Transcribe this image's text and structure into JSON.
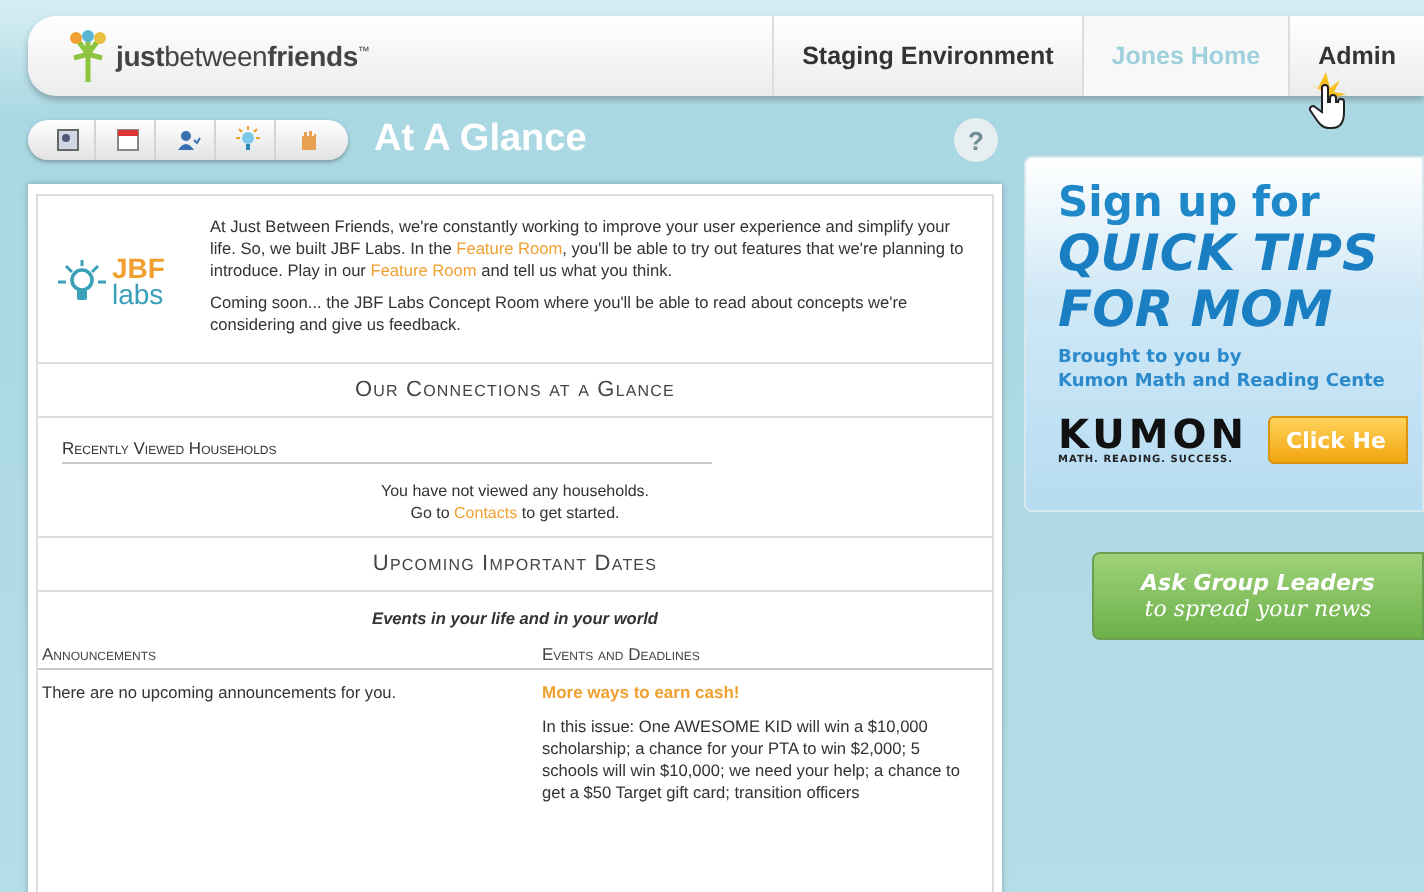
{
  "header": {
    "logo": {
      "bold_start": "just",
      "middle": "between",
      "bold_end": "friends",
      "mark": "™"
    },
    "nav": [
      {
        "label": "Staging Environment",
        "selected": false
      },
      {
        "label": "Jones Home",
        "selected": true
      },
      {
        "label": "Admin",
        "selected": false
      }
    ]
  },
  "toolbar": {
    "title": "At A Glance",
    "help": "?"
  },
  "intro": {
    "logo_top": "JBF",
    "logo_bottom": "labs",
    "paragraphs": [
      [
        {
          "kind": "text",
          "text": "At Just Between Friends, we're constantly working to improve your user experience and simplify your life. So, we built JBF Labs. In the "
        },
        {
          "kind": "link",
          "text": "Feature Room"
        },
        {
          "kind": "text",
          "text": ", you'll be able to try out features that we're planning to introduce. Play in our "
        },
        {
          "kind": "link",
          "text": "Feature Room"
        },
        {
          "kind": "text",
          "text": " and tell us what you think."
        }
      ],
      [
        {
          "kind": "text",
          "text": "Coming soon... the JBF Labs Concept Room where you'll be able to read about concepts we're considering and give us feedback."
        }
      ]
    ]
  },
  "connections": {
    "heading": "Our Connections at a Glance",
    "subheading": "Recently Viewed Households",
    "empty_line": "You have not viewed any households.",
    "go_to": "Go to",
    "link": "Contacts",
    "after_link": "to get started."
  },
  "dates": {
    "heading": "Upcoming Important Dates",
    "tagline": "Events in your life and in your world",
    "announcements": {
      "heading": "Announcements",
      "empty": "There are no upcoming announcements for you."
    },
    "events": {
      "heading": "Events and Deadlines",
      "items": [
        {
          "title": "More ways to earn cash!",
          "body": "In this issue: One AWESOME KID will win a $10,000 scholarship; a chance for your PTA to win $2,000; 5 schools will win $10,000; we need your help; a chance to get a $50 Target gift card; transition officers"
        }
      ]
    }
  },
  "ad": {
    "line1": "Sign up for",
    "line2": "QUICK TIPS",
    "line3": "FOR MOM",
    "byline1": "Brought to you by",
    "byline2": "Kumon Math and Reading Cente",
    "brand": "KUMON",
    "slogan": "MATH. READING. SUCCESS.",
    "cta": "Click He"
  },
  "group_button": {
    "line1": "Ask Group Leaders",
    "line2": "to spread your news"
  }
}
